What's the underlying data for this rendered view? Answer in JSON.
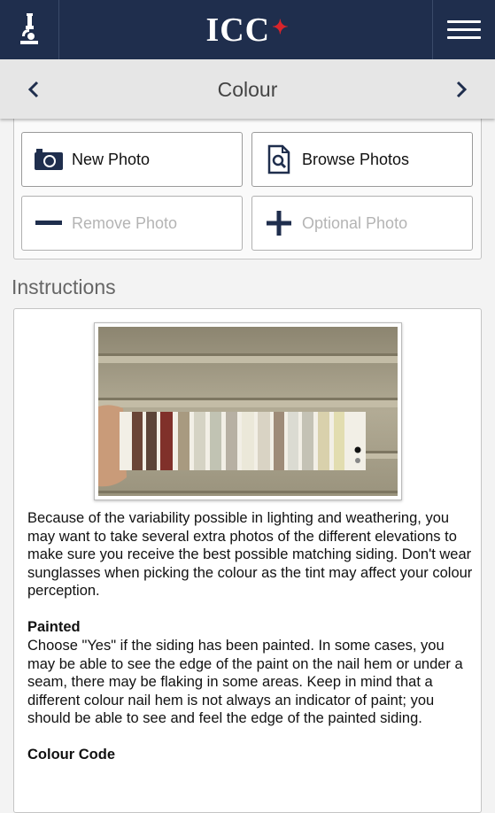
{
  "header": {
    "logo_text": "ICC",
    "logo_mark": "maple-leaf-icon",
    "left_icon": "microscope-icon",
    "right_icon": "menu-icon",
    "colors": {
      "header_bg": "#1f2e4d",
      "leaf": "#d8242b"
    }
  },
  "nav": {
    "title": "Colour",
    "prev_icon": "chevron-left-icon",
    "next_icon": "chevron-right-icon"
  },
  "photo_buttons": {
    "new_photo": "New Photo",
    "browse_photos": "Browse Photos",
    "remove_photo": "Remove Photo",
    "optional_photo": "Optional Photo"
  },
  "instructions": {
    "heading": "Instructions",
    "image_icon": "colour-swatch-photo",
    "intro": "Because of the variability possible in lighting and weathering, you may want to take several extra photos of the different elevations to make sure you receive the best possible matching siding. Don't wear sunglasses when picking the colour as the tint may affect your colour perception.",
    "painted_title": "Painted",
    "painted_text": "Choose \"Yes\" if the siding has been painted. In some cases, you may be able to see the edge of the paint on the nail hem or under a seam, there may be flaking in some areas. Keep in mind that a different colour nail hem is not always an indicator of paint; you should be able to see and feel the edge of the painted siding.",
    "colour_code_title": "Colour Code"
  }
}
